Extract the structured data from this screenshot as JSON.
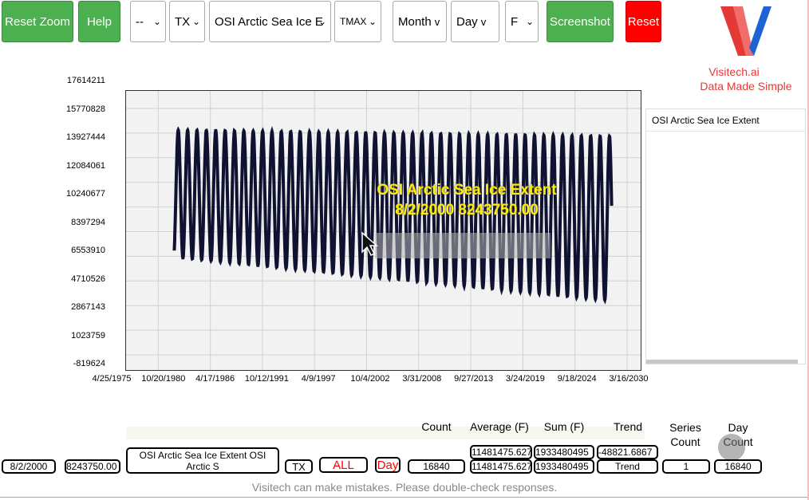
{
  "toolbar": {
    "reset_zoom": "Reset Zoom",
    "help": "Help",
    "filter1": "--",
    "state": "TX",
    "dataset": "OSI Arctic Sea Ice E",
    "metric": "TMAX",
    "month": "Month",
    "month_chev": "v",
    "day": "Day",
    "day_chev": "v",
    "unit": "F",
    "screenshot": "Screenshot",
    "reset": "Reset"
  },
  "brand": {
    "name": "Visitech.ai",
    "tagline": "Data Made Simple",
    "colors": {
      "red": "#e53935",
      "blue": "#1e63d6"
    }
  },
  "legend": {
    "items": [
      "OSI Arctic Sea Ice Extent"
    ]
  },
  "chart_data": {
    "type": "line",
    "series": [
      {
        "name": "OSI Arctic Sea Ice Extent",
        "color": "#0f1230"
      }
    ],
    "y_ticks": [
      "17614211",
      "15770828",
      "13927444",
      "12084061",
      "10240677",
      "8397294",
      "6553910",
      "4710526",
      "2867143",
      "1023759",
      "-819624"
    ],
    "x_ticks": [
      "4/25/1975",
      "10/20/1980",
      "4/17/1986",
      "10/12/1991",
      "4/9/1997",
      "10/4/2002",
      "3/31/2008",
      "9/27/2013",
      "3/24/2019",
      "9/18/2024",
      "3/16/2030"
    ],
    "x_range": [
      "1975-04-25",
      "2030-03-16"
    ],
    "ylim": [
      -819624,
      17614211
    ],
    "grid": true,
    "data_start": "1978-10",
    "data_end": "2025-06",
    "seasonal_max_approx": 16000000,
    "seasonal_min_approx": 6500000,
    "tooltip": {
      "line1": "OSI Arctic Sea Ice Extent",
      "line2": "8/2/2000 8243750.00"
    }
  },
  "summary": {
    "headers": {
      "count": "Count",
      "average": "Average (F)",
      "sum": "Sum (F)",
      "trend": "Trend",
      "series_count": "Series Count",
      "day_count": "Day Count"
    },
    "top_row": {
      "average": "11481475.6270",
      "sum": "1933480495",
      "trend": "-48821.6867"
    },
    "row": {
      "date": "8/2/2000",
      "value": "8243750.00",
      "series": "OSI Arctic Sea Ice Extent OSI Arctic S",
      "state": "TX",
      "all": "ALL",
      "day": "Day",
      "count": "16840",
      "average": "11481475.6270",
      "sum": "1933480495",
      "trend": "Trend",
      "series_count": "1",
      "day_count": "16840"
    }
  },
  "footer": {
    "disclaimer": "Visitech can make mistakes. Please double-check responses."
  }
}
